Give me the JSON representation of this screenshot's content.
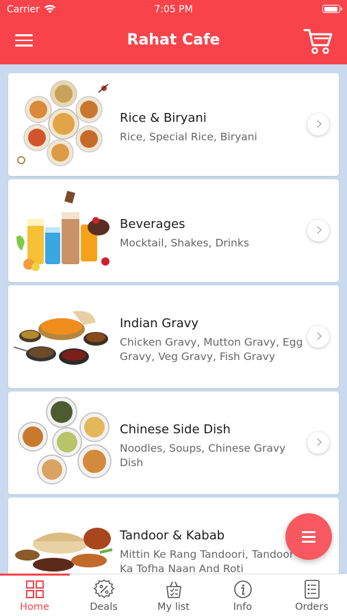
{
  "status_bar": {
    "carrier": "Carrier",
    "time": "7:05 PM"
  },
  "header": {
    "title": "Rahat Cafe",
    "menu_icon": "hamburger-menu-icon",
    "cart_icon": "cart-icon"
  },
  "categories": [
    {
      "title": "Rice & Biryani",
      "subtitle": "Rice, Special Rice, Biryani"
    },
    {
      "title": "Beverages",
      "subtitle": "Mocktail, Shakes, Drinks"
    },
    {
      "title": "Indian Gravy",
      "subtitle": "Chicken Gravy, Mutton Gravy, Egg Gravy, Veg Gravy, Fish Gravy"
    },
    {
      "title": "Chinese Side Dish",
      "subtitle": "Noodles, Soups, Chinese Gravy Dish"
    },
    {
      "title": "Tandoor & Kabab",
      "subtitle": "Mittin Ke Rang Tandoori, Tandoor Ka Tofha Naan And Roti"
    }
  ],
  "tabs": [
    {
      "label": "Home",
      "icon": "grid-icon",
      "active": true
    },
    {
      "label": "Deals",
      "icon": "discount-badge-icon",
      "active": false
    },
    {
      "label": "My list",
      "icon": "basket-list-icon",
      "active": false
    },
    {
      "label": "Info",
      "icon": "info-icon",
      "active": false
    },
    {
      "label": "Orders",
      "icon": "orders-list-icon",
      "active": false
    }
  ],
  "colors": {
    "accent": "#f8434b",
    "background": "#c9d9ee"
  }
}
